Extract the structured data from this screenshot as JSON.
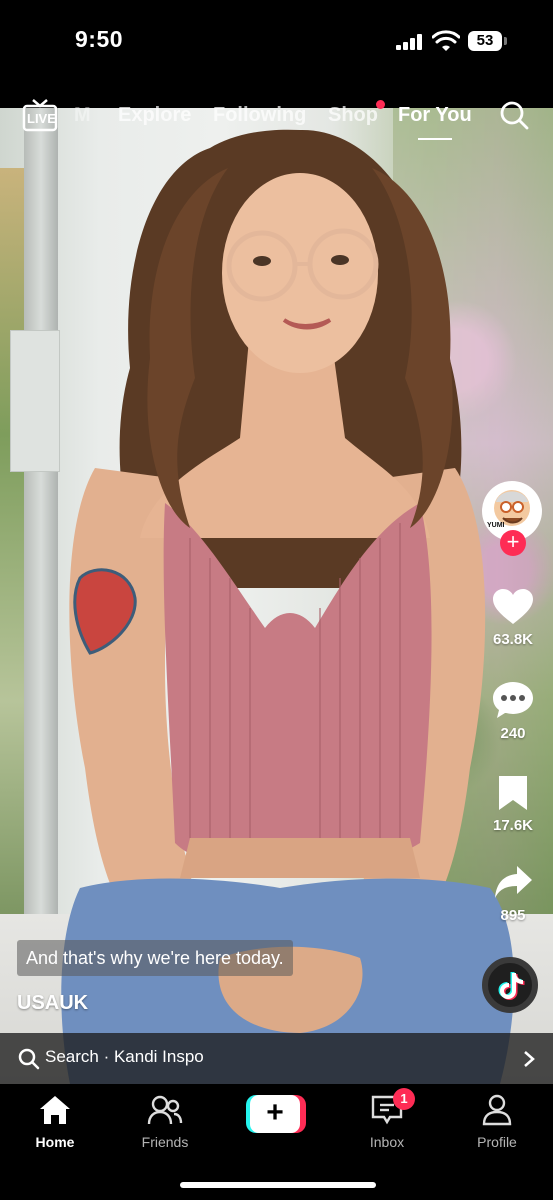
{
  "status_bar": {
    "time": "9:50",
    "battery": "53"
  },
  "top_nav": {
    "live_label": "LIVE",
    "tabs": [
      {
        "label": "M"
      },
      {
        "label": "Explore"
      },
      {
        "label": "Following"
      },
      {
        "label": "Shop"
      },
      {
        "label": "For You",
        "active": true
      }
    ]
  },
  "actions": {
    "avatar_caption": "YUMI",
    "likes": "63.8K",
    "comments": "240",
    "saves": "17.6K",
    "shares": "895"
  },
  "video": {
    "caption": "And that's why we're here today.",
    "author": "USAUK"
  },
  "search_strip": {
    "text": "Search · Kandi Inspo"
  },
  "bottom_nav": {
    "items": [
      {
        "label": "Home"
      },
      {
        "label": "Friends"
      },
      {
        "label": "Inbox",
        "badge": "1"
      },
      {
        "label": "Profile"
      }
    ]
  },
  "colors": {
    "accent": "#fe2c55",
    "create_cyan": "#25f4ee"
  }
}
